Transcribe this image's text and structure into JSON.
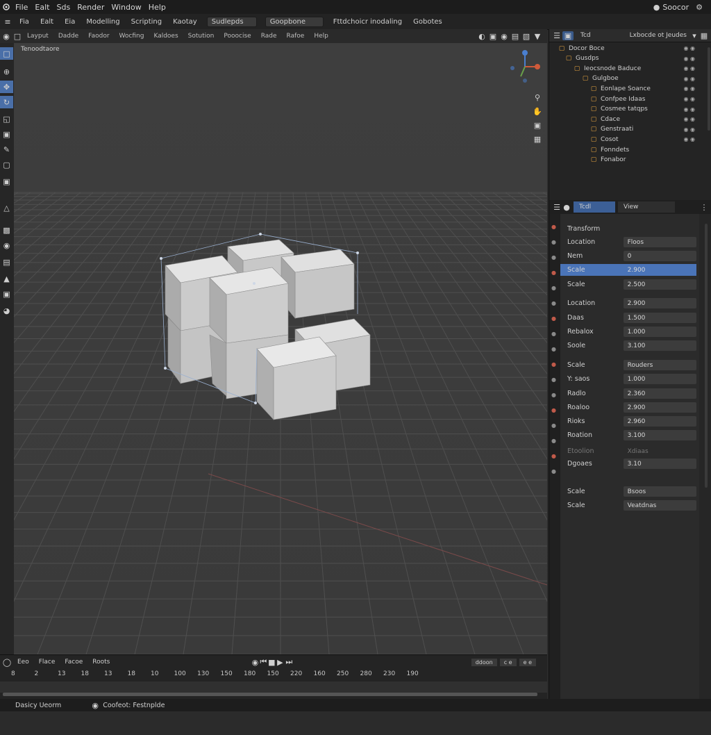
{
  "menu": {
    "items": [
      "File",
      "Ealt",
      "Sds",
      "Render",
      "Window",
      "Help"
    ]
  },
  "top_right": {
    "label": "Soocor"
  },
  "workspace": {
    "tabs": [
      "Fia",
      "Ealt",
      "Eia",
      "Modelling",
      "Scripting",
      "Kaotay"
    ],
    "box1": "Sudlepds",
    "box2": "Goopbone",
    "box3": "Fttdchoicr inodaling",
    "box4": "Gobotes"
  },
  "header": {
    "items": [
      "Layput",
      "Dadde",
      "Faodor",
      "Wocfing",
      "Kaldoes",
      "Sotution",
      "Pooocise",
      "Rade",
      "Rafoe",
      "Help"
    ]
  },
  "viewport": {
    "mode_label": "Tenoodtaore"
  },
  "outliner": {
    "tab": "Tcd",
    "title": "Lxbocde ot Jeudes",
    "rows": [
      "Docor Boce",
      "Gusdps",
      "Ieocsnode Baduce",
      "Gulgboe",
      "Eonlape Soance",
      "Confpee Idaas",
      "Cosmee tatqps",
      "Cdace",
      "Genstraati",
      "Cosot",
      "Fonndets",
      "Fonabor"
    ]
  },
  "properties": {
    "tabs": [
      "Tcdl",
      "View"
    ],
    "section": "Transform",
    "rows": [
      {
        "label": "Location",
        "value": "Floos"
      },
      {
        "label": "Nem",
        "value": "0"
      },
      {
        "label": "Scale",
        "value": "2.900"
      },
      {
        "label": "Scale",
        "value": "2.500"
      },
      {
        "label": "Location",
        "value": "2.900"
      },
      {
        "label": "Daas",
        "value": "1.500"
      },
      {
        "label": "Rebalox",
        "value": "1.000"
      },
      {
        "label": "Soole",
        "value": "3.100"
      },
      {
        "label": "Scale",
        "value": "Rouders"
      },
      {
        "label": "Y: saos",
        "value": "1.000"
      },
      {
        "label": "Radlo",
        "value": "2.360"
      },
      {
        "label": "Roaloo",
        "value": "2.900"
      },
      {
        "label": "Rioks",
        "value": "2.960"
      },
      {
        "label": "Roation",
        "value": "3.100"
      },
      {
        "label": "Etoolion",
        "value": "Xdiaas"
      },
      {
        "label": "Dgoaes",
        "value": "3.10"
      },
      {
        "label": "Scale",
        "value": "Bsoos"
      },
      {
        "label": "Scale",
        "value": "Veatdnas"
      }
    ]
  },
  "timeline": {
    "menu": [
      "Eeo",
      "Flace",
      "Facoe",
      "Roots"
    ],
    "box1": "ddoon",
    "box2": "c e",
    "box3": "e e",
    "frames": [
      "8",
      "2",
      "13",
      "18",
      "13",
      "18",
      "10",
      "100",
      "130",
      "150",
      "180",
      "150",
      "220",
      "160",
      "250",
      "280",
      "230",
      "190"
    ]
  },
  "status": {
    "left": "Dasicy Ueorm",
    "right": "Coofeot: Festnplde"
  },
  "colors": {
    "accent": "#4a74b8",
    "bg": "#2b2b2b",
    "viewport": "#3d3d3d",
    "cube": "#c9c9c9"
  }
}
